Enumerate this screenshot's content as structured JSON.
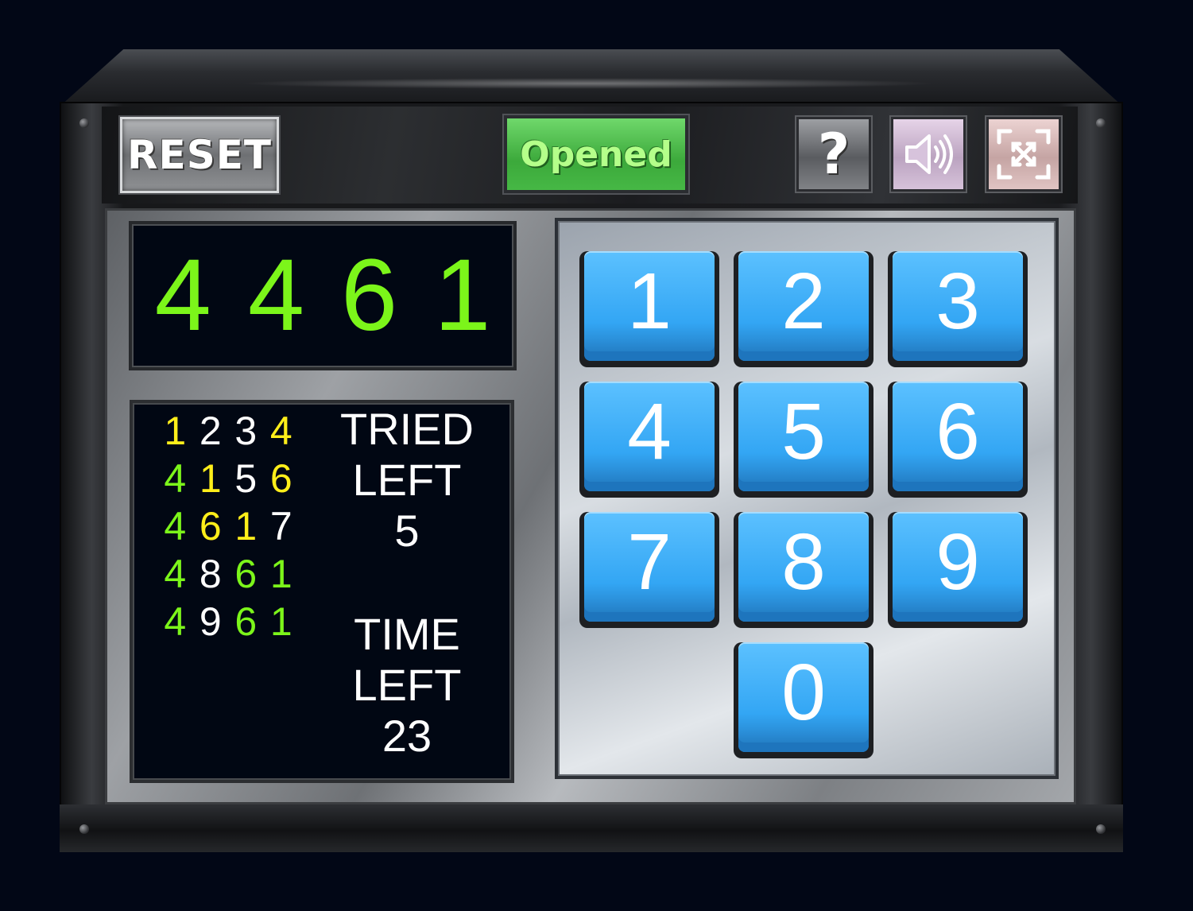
{
  "toolbar": {
    "reset_label": "RESET",
    "status_label": "Opened",
    "help_label": "?",
    "sound_icon": "speaker-icon",
    "fullscreen_icon": "fullscreen-icon",
    "colors": {
      "status_bg": "#46b845",
      "status_text": "#b4ff8a"
    }
  },
  "display": {
    "code": [
      "4",
      "4",
      "6",
      "1"
    ]
  },
  "history": {
    "attempts": [
      {
        "digits": [
          "1",
          "2",
          "3",
          "4"
        ],
        "colors": [
          "yellow",
          "white",
          "white",
          "yellow"
        ]
      },
      {
        "digits": [
          "4",
          "1",
          "5",
          "6"
        ],
        "colors": [
          "green",
          "yellow",
          "white",
          "yellow"
        ]
      },
      {
        "digits": [
          "4",
          "6",
          "1",
          "7"
        ],
        "colors": [
          "green",
          "yellow",
          "yellow",
          "white"
        ]
      },
      {
        "digits": [
          "4",
          "8",
          "6",
          "1"
        ],
        "colors": [
          "green",
          "white",
          "green",
          "green"
        ]
      },
      {
        "digits": [
          "4",
          "9",
          "6",
          "1"
        ],
        "colors": [
          "green",
          "white",
          "green",
          "green"
        ]
      }
    ],
    "legend_colors": {
      "green": "#7cf51a",
      "yellow": "#ffee1a",
      "white": "#ffffff"
    }
  },
  "info": {
    "tried_line1": "TRIED",
    "tried_line2": "LEFT",
    "tried_value": "5",
    "time_line1": "TIME",
    "time_line2": "LEFT",
    "time_value": "23"
  },
  "keypad": {
    "keys": [
      "1",
      "2",
      "3",
      "4",
      "5",
      "6",
      "7",
      "8",
      "9",
      "0"
    ]
  }
}
